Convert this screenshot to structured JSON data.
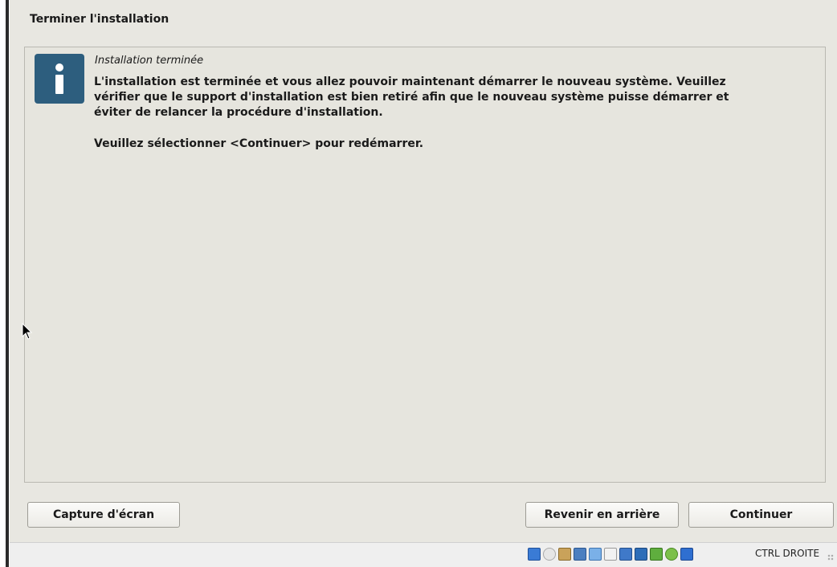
{
  "installer": {
    "title": "Terminer l'installation",
    "message": {
      "subtitle": "Installation terminée",
      "line1": "L'installation est terminée et vous allez pouvoir maintenant démarrer le nouveau système. Veuillez",
      "line2": "vérifier que le support d'installation est bien retiré afin que le nouveau système puisse démarrer et",
      "line3": "éviter de relancer la procédure d'installation.",
      "prompt": "Veuillez sélectionner <Continuer> pour redémarrer."
    },
    "buttons": {
      "screenshot": "Capture d'écran",
      "back": "Revenir en arrière",
      "continue": "Continuer"
    }
  },
  "statusbar": {
    "icons": [
      "hard-disk-icon",
      "optical-drive-icon",
      "audio-icon",
      "network-icon",
      "usb-icon",
      "shared-folder-icon",
      "display-icon",
      "video-capture-icon",
      "recording-icon",
      "mouse-integration-icon",
      "keyboard-capture-icon"
    ],
    "host_key": "CTRL DROITE"
  },
  "colors": {
    "background": "#e8e7e1",
    "info_icon": "#2d5e7e"
  }
}
